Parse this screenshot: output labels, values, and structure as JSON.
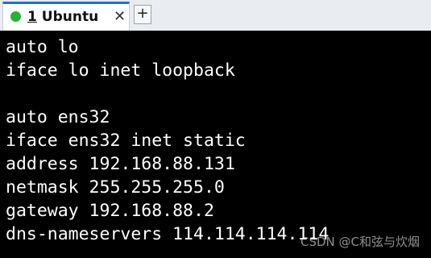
{
  "tab": {
    "number": "1",
    "title": "Ubuntu",
    "status_color": "#22b33a",
    "close_symbol": "✕",
    "active_accent": "#1a73d9"
  },
  "new_tab": {
    "symbol": "+"
  },
  "terminal": {
    "lines": [
      "auto lo",
      "iface lo inet loopback",
      "",
      "auto ens32",
      "iface ens32 inet static",
      "address 192.168.88.131",
      "netmask 255.255.255.0",
      "gateway 192.168.88.2",
      "dns-nameservers 114.114.114.114"
    ]
  },
  "watermark": {
    "text": "CSDN @C和弦与炊烟"
  }
}
